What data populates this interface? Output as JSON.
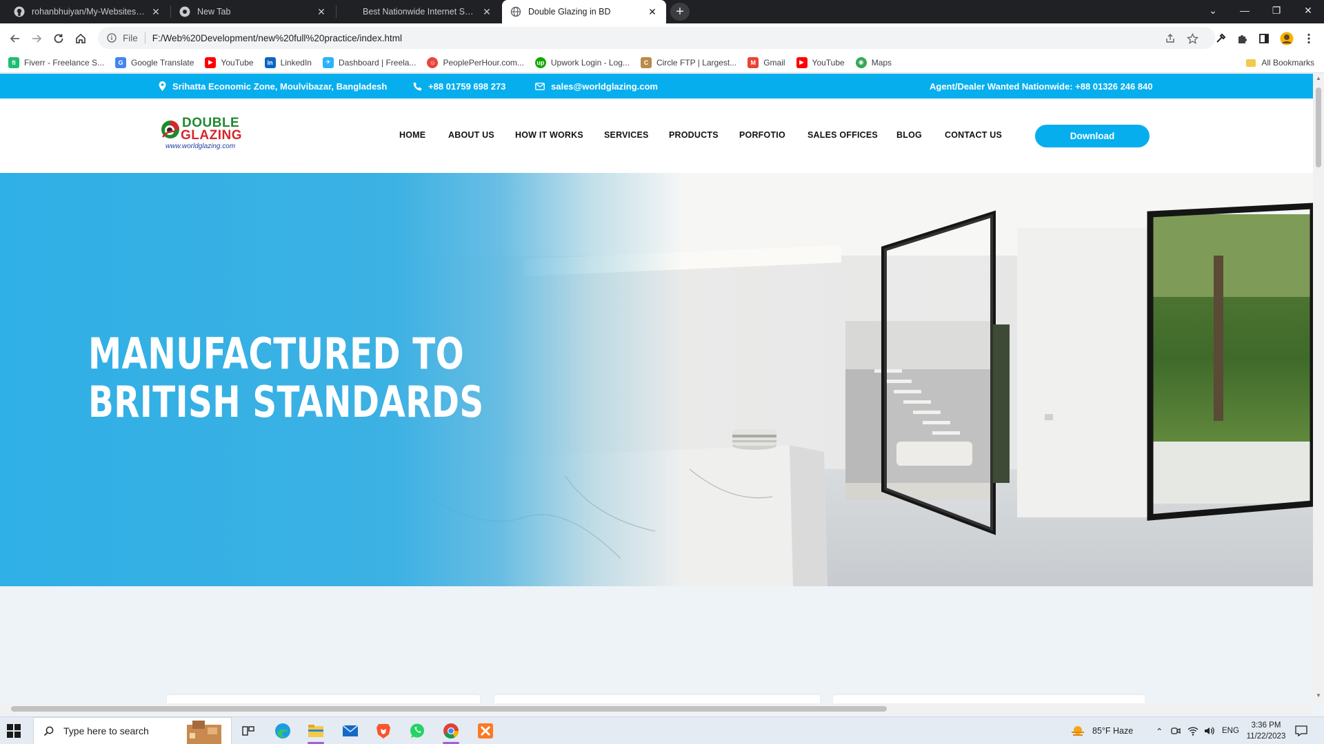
{
  "browser": {
    "tabs": [
      {
        "title": "rohanbhuiyan/My-Websites: I ha",
        "icon": "github-icon",
        "active": false
      },
      {
        "title": "New Tab",
        "icon": "chrome-icon",
        "active": false
      },
      {
        "title": "Best Nationwide Internet Service",
        "icon": "blank-icon",
        "active": false
      },
      {
        "title": "Double Glazing in BD",
        "icon": "globe-icon",
        "active": true
      }
    ],
    "url_scheme": "File",
    "url": "F:/Web%20Development/new%20full%20practice/index.html",
    "bookmarks": [
      {
        "label": "Fiverr - Freelance S...",
        "icon": "fiverr-icon",
        "color": "#1dbf73",
        "glyph": "fi"
      },
      {
        "label": "Google Translate",
        "icon": "translate-icon",
        "color": "#4285f4",
        "glyph": "G"
      },
      {
        "label": "YouTube",
        "icon": "youtube-icon",
        "color": "#ff0000",
        "glyph": "▶"
      },
      {
        "label": "LinkedIn",
        "icon": "linkedin-icon",
        "color": "#0a66c2",
        "glyph": "in"
      },
      {
        "label": "Dashboard | Freela...",
        "icon": "freelancer-icon",
        "color": "#29b2fe",
        "glyph": "✈"
      },
      {
        "label": "PeoplePerHour.com...",
        "icon": "peopleperhour-icon",
        "color": "#e8453c",
        "glyph": "☺"
      },
      {
        "label": "Upwork Login - Log...",
        "icon": "upwork-icon",
        "color": "#14a800",
        "glyph": "up"
      },
      {
        "label": "Circle FTP | Largest...",
        "icon": "circleftp-icon",
        "color": "#b98a4a",
        "glyph": "C"
      },
      {
        "label": "Gmail",
        "icon": "gmail-icon",
        "color": "#ea4335",
        "glyph": "M"
      },
      {
        "label": "YouTube",
        "icon": "youtube-icon",
        "color": "#ff0000",
        "glyph": "▶"
      },
      {
        "label": "Maps",
        "icon": "maps-icon",
        "color": "#34a853",
        "glyph": "◉"
      }
    ],
    "all_bookmarks": "All Bookmarks"
  },
  "site": {
    "topbar": {
      "address": "Srihatta Economic Zone, Moulvibazar, Bangladesh",
      "phone": "+88 01759 698 273",
      "email": "sales@worldglazing.com",
      "agent": "Agent/Dealer Wanted Nationwide: +88 01326 246 840"
    },
    "logo": {
      "line1": "DOUBLE",
      "line2": "GLAZING",
      "url": "www.worldglazing.com"
    },
    "nav": [
      "HOME",
      "ABOUT US",
      "HOW IT WORKS",
      "SERVICES",
      "PRODUCTS",
      "PORFOTIO",
      "SALES OFFICES",
      "BLOG",
      "CONTACT US"
    ],
    "download_label": "Download",
    "hero": {
      "line1": "MANUFACTURED TO",
      "line2": "BRITISH STANDARDS"
    },
    "colors": {
      "accent": "#07aeee",
      "logo_green": "#1d8a2e",
      "logo_red": "#d6262b"
    }
  },
  "taskbar": {
    "search_placeholder": "Type here to search",
    "weather": "85°F  Haze",
    "lang": "ENG",
    "time": "3:36 PM",
    "date": "11/22/2023"
  }
}
